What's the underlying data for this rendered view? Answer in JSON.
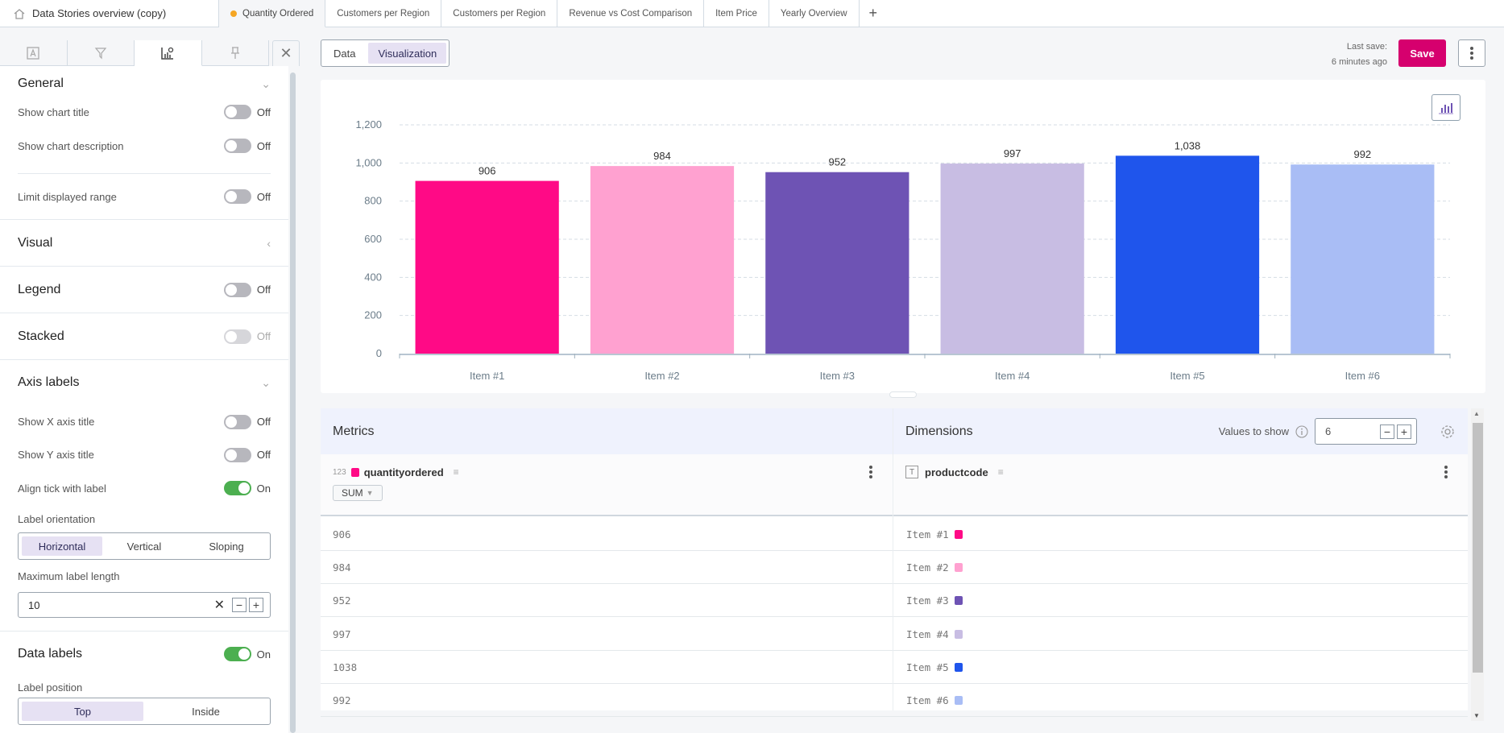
{
  "topbar": {
    "story_title": "Data Stories overview (copy)",
    "tabs": [
      {
        "label": "Quantity Ordered",
        "active": true,
        "unsaved": true
      },
      {
        "label": "Customers per Region"
      },
      {
        "label": "Customers per Region"
      },
      {
        "label": "Revenue vs Cost Comparison"
      },
      {
        "label": "Item Price"
      },
      {
        "label": "Yearly Overview"
      }
    ],
    "add_tab": "+"
  },
  "panel": {
    "tabs": [
      "text-icon",
      "filter-icon",
      "chart-settings-icon",
      "pin-icon"
    ],
    "close": "✕",
    "general": {
      "title": "General",
      "show_chart_title": {
        "label": "Show chart title",
        "state": "Off"
      },
      "show_chart_description": {
        "label": "Show chart description",
        "state": "Off"
      },
      "limit_displayed_range": {
        "label": "Limit displayed range",
        "state": "Off"
      }
    },
    "visual": {
      "title": "Visual"
    },
    "legend": {
      "title": "Legend",
      "state": "Off"
    },
    "stacked": {
      "title": "Stacked",
      "state": "Off"
    },
    "axis_labels": {
      "title": "Axis labels",
      "show_x_axis_title": {
        "label": "Show X axis title",
        "state": "Off"
      },
      "show_y_axis_title": {
        "label": "Show Y axis title",
        "state": "Off"
      },
      "align_tick": {
        "label": "Align tick with label",
        "state": "On"
      },
      "label_orientation": {
        "label": "Label orientation",
        "options": [
          "Horizontal",
          "Vertical",
          "Sloping"
        ],
        "selected": "Horizontal"
      },
      "max_label_length": {
        "label": "Maximum label length",
        "value": "10"
      }
    },
    "data_labels": {
      "title": "Data labels",
      "state": "On",
      "label_position": {
        "label": "Label position",
        "options": [
          "Top",
          "Inside"
        ],
        "selected": "Top"
      }
    }
  },
  "main": {
    "view_switch": {
      "data": "Data",
      "visualization": "Visualization",
      "selected": "Visualization"
    },
    "last_save_label": "Last save:",
    "last_save_value": "6 minutes ago",
    "save": "Save"
  },
  "chart_data": {
    "type": "bar",
    "title": "",
    "xlabel": "",
    "ylabel": "",
    "categories": [
      "Item #1",
      "Item #2",
      "Item #3",
      "Item #4",
      "Item #5",
      "Item #6"
    ],
    "values": [
      906,
      984,
      952,
      997,
      1038,
      992
    ],
    "value_labels": [
      "906",
      "984",
      "952",
      "997",
      "1,038",
      "992"
    ],
    "colors": [
      "#ff0a86",
      "#ffa1d0",
      "#6e53b4",
      "#c8bde3",
      "#1f55ec",
      "#a9bdf5"
    ],
    "ylim": [
      0,
      1200
    ],
    "yticks": [
      "0",
      "200",
      "400",
      "600",
      "800",
      "1,000",
      "1,200"
    ],
    "grid": true,
    "legend": "none"
  },
  "grid": {
    "metrics_title": "Metrics",
    "dimensions_title": "Dimensions",
    "values_to_show_label": "Values to show",
    "values_to_show": "6",
    "metric": {
      "type": "123",
      "name": "quantityordered",
      "aggregation": "SUM",
      "color": "#ff0a86"
    },
    "dimension": {
      "type": "T",
      "name": "productcode"
    },
    "rows": [
      {
        "value": "906",
        "item": "Item #1"
      },
      {
        "value": "984",
        "item": "Item #2"
      },
      {
        "value": "952",
        "item": "Item #3"
      },
      {
        "value": "997",
        "item": "Item #4"
      },
      {
        "value": "1038",
        "item": "Item #5"
      },
      {
        "value": "992",
        "item": "Item #6"
      }
    ]
  }
}
